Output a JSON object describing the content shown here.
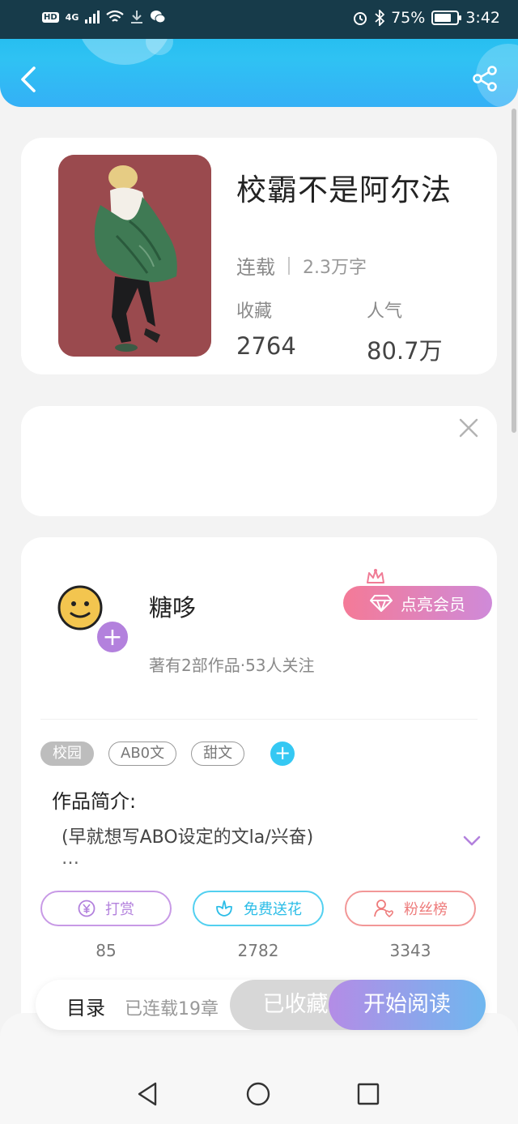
{
  "status_bar": {
    "network": "4G",
    "hd": "HD",
    "battery_percent": "75%",
    "battery_level": 0.75,
    "time": "3:42"
  },
  "header": {
    "back_icon": "chevron-left-icon",
    "share_icon": "share-icon"
  },
  "book": {
    "title": "校霸不是阿尔法",
    "status": "连载",
    "word_count": "2.3万字",
    "collect_label": "收藏",
    "collect_count": "2764",
    "popularity_label": "人气",
    "popularity_count": "80.7万"
  },
  "author": {
    "name": "糖哆",
    "meta": "著有2部作品·53人关注",
    "follow_plus": "+",
    "vip_button": "点亮会员"
  },
  "tags": [
    "校园",
    "AB0文",
    "甜文"
  ],
  "tag_add": "+",
  "intro": {
    "title": "作品简介:",
    "text": "(早就想写ABO设定的文la/兴奋)",
    "ellipsis": "…"
  },
  "actions": [
    {
      "label": "打赏",
      "count": "85",
      "icon": "yen-icon"
    },
    {
      "label": "免费送花",
      "count": "2782",
      "icon": "flower-icon"
    },
    {
      "label": "粉丝榜",
      "count": "3343",
      "icon": "fan-user-icon"
    }
  ],
  "bottom_bar": {
    "toc_label": "目录",
    "chapters_label": "已连载19章",
    "collected_label": "已收藏",
    "read_label": "开始阅读"
  },
  "colors": {
    "header_blue": "#2fc2f3",
    "vip_pink": "#f47a97",
    "purple": "#b381dd"
  }
}
